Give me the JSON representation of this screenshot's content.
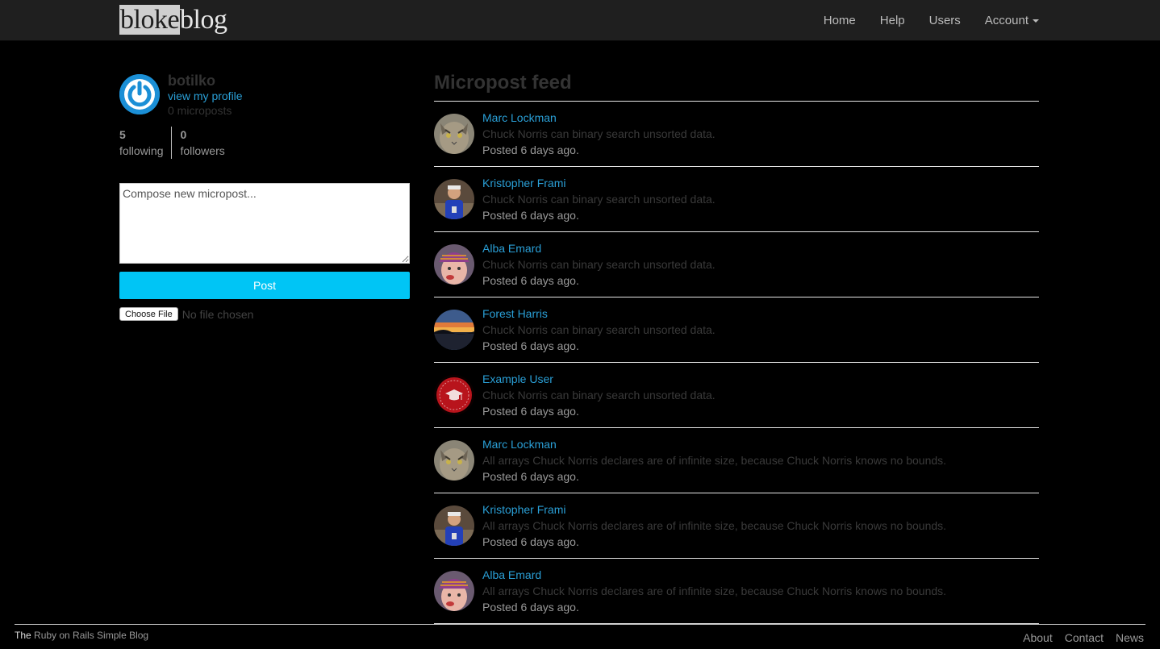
{
  "navbar": {
    "logo_part1": "bloke",
    "logo_part2": "blog",
    "links": [
      "Home",
      "Help",
      "Users",
      "Account"
    ]
  },
  "sidebar": {
    "username": "botilko",
    "profile_link": "view my profile",
    "micropost_count": "0 microposts",
    "following_count": "5",
    "following_label": "following",
    "followers_count": "0",
    "followers_label": "followers",
    "compose_placeholder": "Compose new micropost...",
    "post_button": "Post",
    "file_button": "Choose File",
    "file_status": "No file chosen"
  },
  "feed": {
    "title": "Micropost feed",
    "items": [
      {
        "user": "Marc Lockman",
        "content": "Chuck Norris can binary search unsorted data.",
        "time": "Posted 6 days ago.",
        "avatar": "cat-avatar"
      },
      {
        "user": "Kristopher Frami",
        "content": "Chuck Norris can binary search unsorted data.",
        "time": "Posted 6 days ago.",
        "avatar": "person-blue-shirt-avatar"
      },
      {
        "user": "Alba Emard",
        "content": "Chuck Norris can binary search unsorted data.",
        "time": "Posted 6 days ago.",
        "avatar": "child-knit-hat-avatar"
      },
      {
        "user": "Forest Harris",
        "content": "Chuck Norris can binary search unsorted data.",
        "time": "Posted 6 days ago.",
        "avatar": "sunset-avatar"
      },
      {
        "user": "Example User",
        "content": "Chuck Norris can binary search unsorted data.",
        "time": "Posted 6 days ago.",
        "avatar": "graduation-cap-seal-avatar"
      },
      {
        "user": "Marc Lockman",
        "content": "All arrays Chuck Norris declares are of infinite size, because Chuck Norris knows no bounds.",
        "time": "Posted 6 days ago.",
        "avatar": "cat-avatar"
      },
      {
        "user": "Kristopher Frami",
        "content": "All arrays Chuck Norris declares are of infinite size, because Chuck Norris knows no bounds.",
        "time": "Posted 6 days ago.",
        "avatar": "person-blue-shirt-avatar"
      },
      {
        "user": "Alba Emard",
        "content": "All arrays Chuck Norris declares are of infinite size, because Chuck Norris knows no bounds.",
        "time": "Posted 6 days ago.",
        "avatar": "child-knit-hat-avatar"
      }
    ]
  },
  "footer": {
    "brand_part1": "The",
    "brand_part2": " Ruby on Rails Simple Blog",
    "links": [
      "About",
      "Contact",
      "News"
    ]
  },
  "colors": {
    "accent_link": "#2a9fd6",
    "post_button": "#00c5f5",
    "navbar_bg": "#1f1f1f"
  }
}
